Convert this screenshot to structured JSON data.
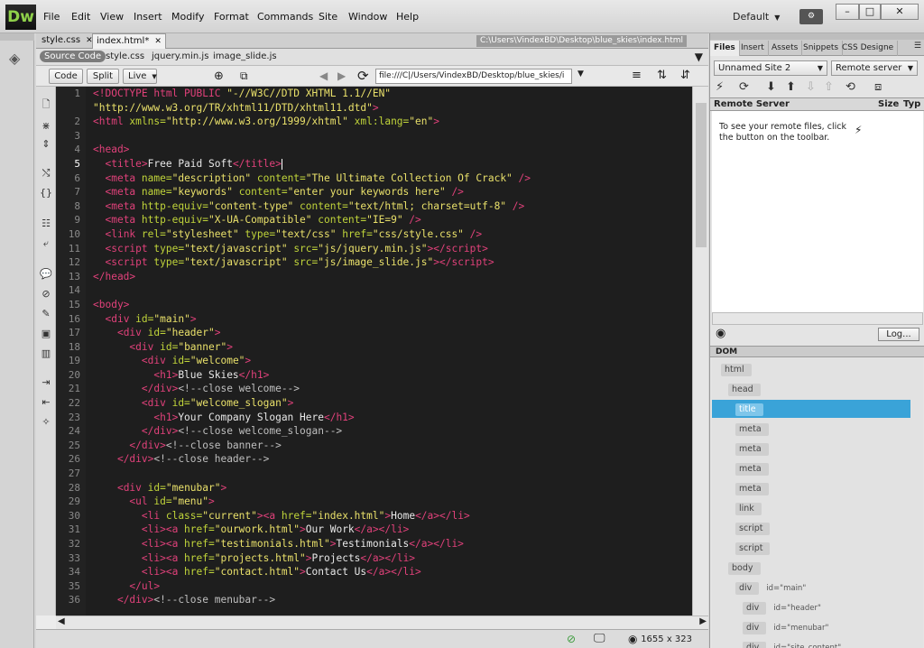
{
  "app": {
    "logo": "Dw",
    "menu": [
      "File",
      "Edit",
      "View",
      "Insert",
      "Modify",
      "Format",
      "Commands",
      "Site",
      "Window",
      "Help"
    ],
    "workspace": "Default",
    "win": [
      "–",
      "□",
      "✕"
    ]
  },
  "tabs": {
    "items": [
      "style.css",
      "index.html*"
    ],
    "path": "C:\\Users\\VindexBD\\Desktop\\blue_skies\\index.html"
  },
  "related": {
    "source": "Source Code",
    "files": [
      "style.css",
      "jquery.min.js",
      "image_slide.js"
    ]
  },
  "viewbar": {
    "code": "Code",
    "split": "Split",
    "live": "Live",
    "address": "file:///C|/Users/VindexBD/Desktop/blue_skies/i"
  },
  "lines": [
    {
      "n": "1",
      "h": "<span class='t'>&lt;!DOCTYPE html PUBLIC </span><span class='v'>\"-//W3C//DTD XHTML 1.1//EN\"</span>"
    },
    {
      "n": "",
      "h": "<span class='v'>\"http://www.w3.org/TR/xhtml11/DTD/xhtml11.dtd\"</span><span class='t'>&gt;</span>"
    },
    {
      "n": "2",
      "h": "<span class='t'>&lt;html </span><span class='a'>xmlns=</span><span class='v'>\"http://www.w3.org/1999/xhtml\"</span><span class='a'> xml:lang=</span><span class='v'>\"en\"</span><span class='t'>&gt;</span>"
    },
    {
      "n": "3",
      "h": ""
    },
    {
      "n": "4",
      "h": "<span class='t'>&lt;head&gt;</span>"
    },
    {
      "n": "5",
      "h": "  <span class='t'>&lt;title&gt;</span><span class='tx'>Free Paid Soft</span><span class='t'>&lt;/title&gt;</span><span id='cursor'></span>",
      "cur": true
    },
    {
      "n": "6",
      "h": "  <span class='t'>&lt;meta </span><span class='a'>name=</span><span class='v'>\"description\"</span><span class='a'> content=</span><span class='v'>\"The Ultimate Collection Of Crack\"</span><span class='t'> /&gt;</span>"
    },
    {
      "n": "7",
      "h": "  <span class='t'>&lt;meta </span><span class='a'>name=</span><span class='v'>\"keywords\"</span><span class='a'> content=</span><span class='v'>\"enter your keywords here\"</span><span class='t'> /&gt;</span>"
    },
    {
      "n": "8",
      "h": "  <span class='t'>&lt;meta </span><span class='a'>http-equiv=</span><span class='v'>\"content-type\"</span><span class='a'> content=</span><span class='v'>\"text/html; charset=utf-8\"</span><span class='t'> /&gt;</span>"
    },
    {
      "n": "9",
      "h": "  <span class='t'>&lt;meta </span><span class='a'>http-equiv=</span><span class='v'>\"X-UA-Compatible\"</span><span class='a'> content=</span><span class='v'>\"IE=9\"</span><span class='t'> /&gt;</span>"
    },
    {
      "n": "10",
      "h": "  <span class='t'>&lt;link </span><span class='a'>rel=</span><span class='v'>\"stylesheet\"</span><span class='a'> type=</span><span class='v'>\"text/css\"</span><span class='a'> href=</span><span class='v'>\"css/style.css\"</span><span class='t'> /&gt;</span>"
    },
    {
      "n": "11",
      "h": "  <span class='t'>&lt;script </span><span class='a'>type=</span><span class='v'>\"text/javascript\"</span><span class='a'> src=</span><span class='v'>\"js/jquery.min.js\"</span><span class='t'>&gt;&lt;/script&gt;</span>"
    },
    {
      "n": "12",
      "h": "  <span class='t'>&lt;script </span><span class='a'>type=</span><span class='v'>\"text/javascript\"</span><span class='a'> src=</span><span class='v'>\"js/image_slide.js\"</span><span class='t'>&gt;&lt;/script&gt;</span>"
    },
    {
      "n": "13",
      "h": "<span class='t'>&lt;/head&gt;</span>"
    },
    {
      "n": "14",
      "h": ""
    },
    {
      "n": "15",
      "h": "<span class='t'>&lt;body&gt;</span>"
    },
    {
      "n": "16",
      "h": "  <span class='t'>&lt;div </span><span class='a'>id=</span><span class='v'>\"main\"</span><span class='t'>&gt;</span>"
    },
    {
      "n": "17",
      "h": "    <span class='t'>&lt;div </span><span class='a'>id=</span><span class='v'>\"header\"</span><span class='t'>&gt;</span>"
    },
    {
      "n": "18",
      "h": "      <span class='t'>&lt;div </span><span class='a'>id=</span><span class='v'>\"banner\"</span><span class='t'>&gt;</span>"
    },
    {
      "n": "19",
      "h": "        <span class='t'>&lt;div </span><span class='a'>id=</span><span class='v'>\"welcome\"</span><span class='t'>&gt;</span>"
    },
    {
      "n": "20",
      "h": "          <span class='t'>&lt;h1&gt;</span><span class='tx'>Blue Skies</span><span class='t'>&lt;/h1&gt;</span>"
    },
    {
      "n": "21",
      "h": "        <span class='t'>&lt;/div&gt;</span><span class='c'>&lt;!--close welcome--&gt;</span>"
    },
    {
      "n": "22",
      "h": "        <span class='t'>&lt;div </span><span class='a'>id=</span><span class='v'>\"welcome_slogan\"</span><span class='t'>&gt;</span>"
    },
    {
      "n": "23",
      "h": "          <span class='t'>&lt;h1&gt;</span><span class='tx'>Your Company Slogan Here</span><span class='t'>&lt;/h1&gt;</span>"
    },
    {
      "n": "24",
      "h": "        <span class='t'>&lt;/div&gt;</span><span class='c'>&lt;!--close welcome_slogan--&gt;</span>"
    },
    {
      "n": "25",
      "h": "      <span class='t'>&lt;/div&gt;</span><span class='c'>&lt;!--close banner--&gt;</span>"
    },
    {
      "n": "26",
      "h": "    <span class='t'>&lt;/div&gt;</span><span class='c'>&lt;!--close header--&gt;</span>"
    },
    {
      "n": "27",
      "h": ""
    },
    {
      "n": "28",
      "h": "    <span class='t'>&lt;div </span><span class='a'>id=</span><span class='v'>\"menubar\"</span><span class='t'>&gt;</span>"
    },
    {
      "n": "29",
      "h": "      <span class='t'>&lt;ul </span><span class='a'>id=</span><span class='v'>\"menu\"</span><span class='t'>&gt;</span>"
    },
    {
      "n": "30",
      "h": "        <span class='t'>&lt;li </span><span class='a'>class=</span><span class='v'>\"current\"</span><span class='t'>&gt;&lt;a </span><span class='a'>href=</span><span class='v'>\"index.html\"</span><span class='t'>&gt;</span><span class='tx'>Home</span><span class='t'>&lt;/a&gt;&lt;/li&gt;</span>"
    },
    {
      "n": "31",
      "h": "        <span class='t'>&lt;li&gt;&lt;a </span><span class='a'>href=</span><span class='v'>\"ourwork.html\"</span><span class='t'>&gt;</span><span class='tx'>Our Work</span><span class='t'>&lt;/a&gt;&lt;/li&gt;</span>"
    },
    {
      "n": "32",
      "h": "        <span class='t'>&lt;li&gt;&lt;a </span><span class='a'>href=</span><span class='v'>\"testimonials.html\"</span><span class='t'>&gt;</span><span class='tx'>Testimonials</span><span class='t'>&lt;/a&gt;&lt;/li&gt;</span>"
    },
    {
      "n": "33",
      "h": "        <span class='t'>&lt;li&gt;&lt;a </span><span class='a'>href=</span><span class='v'>\"projects.html\"</span><span class='t'>&gt;</span><span class='tx'>Projects</span><span class='t'>&lt;/a&gt;&lt;/li&gt;</span>"
    },
    {
      "n": "34",
      "h": "        <span class='t'>&lt;li&gt;&lt;a </span><span class='a'>href=</span><span class='v'>\"contact.html\"</span><span class='t'>&gt;</span><span class='tx'>Contact Us</span><span class='t'>&lt;/a&gt;&lt;/li&gt;</span>"
    },
    {
      "n": "35",
      "h": "      <span class='t'>&lt;/ul&gt;</span>"
    },
    {
      "n": "36",
      "h": "    <span class='t'>&lt;/div&gt;</span><span class='c'>&lt;!--close menubar--&gt;</span>"
    }
  ],
  "status": {
    "size": "1655 x 323"
  },
  "files": {
    "tabs": [
      "Files",
      "Insert",
      "Assets",
      "Snippets",
      "CSS Designe"
    ],
    "site": "Unnamed Site 2",
    "server": "Remote server",
    "col1": "Remote Server",
    "col2": "Size",
    "col3": "Typ",
    "message": "To see your remote files, click the button on the toolbar.",
    "log": "Log..."
  },
  "dom": {
    "tab": "DOM",
    "nodes": [
      {
        "tag": "html",
        "attr": "",
        "indent": 0
      },
      {
        "tag": "head",
        "attr": "",
        "indent": 1
      },
      {
        "tag": "title",
        "attr": "",
        "indent": 2,
        "selected": true
      },
      {
        "tag": "meta",
        "attr": "",
        "indent": 2
      },
      {
        "tag": "meta",
        "attr": "",
        "indent": 2
      },
      {
        "tag": "meta",
        "attr": "",
        "indent": 2
      },
      {
        "tag": "meta",
        "attr": "",
        "indent": 2
      },
      {
        "tag": "link",
        "attr": "",
        "indent": 2
      },
      {
        "tag": "script",
        "attr": "",
        "indent": 2
      },
      {
        "tag": "script",
        "attr": "",
        "indent": 2
      },
      {
        "tag": "body",
        "attr": "",
        "indent": 1
      },
      {
        "tag": "div",
        "attr": "id=\"main\"",
        "indent": 2
      },
      {
        "tag": "div",
        "attr": "id=\"header\"",
        "indent": 3
      },
      {
        "tag": "div",
        "attr": "id=\"menubar\"",
        "indent": 3
      },
      {
        "tag": "div",
        "attr": "id=\"site_content\"",
        "indent": 3
      }
    ]
  }
}
